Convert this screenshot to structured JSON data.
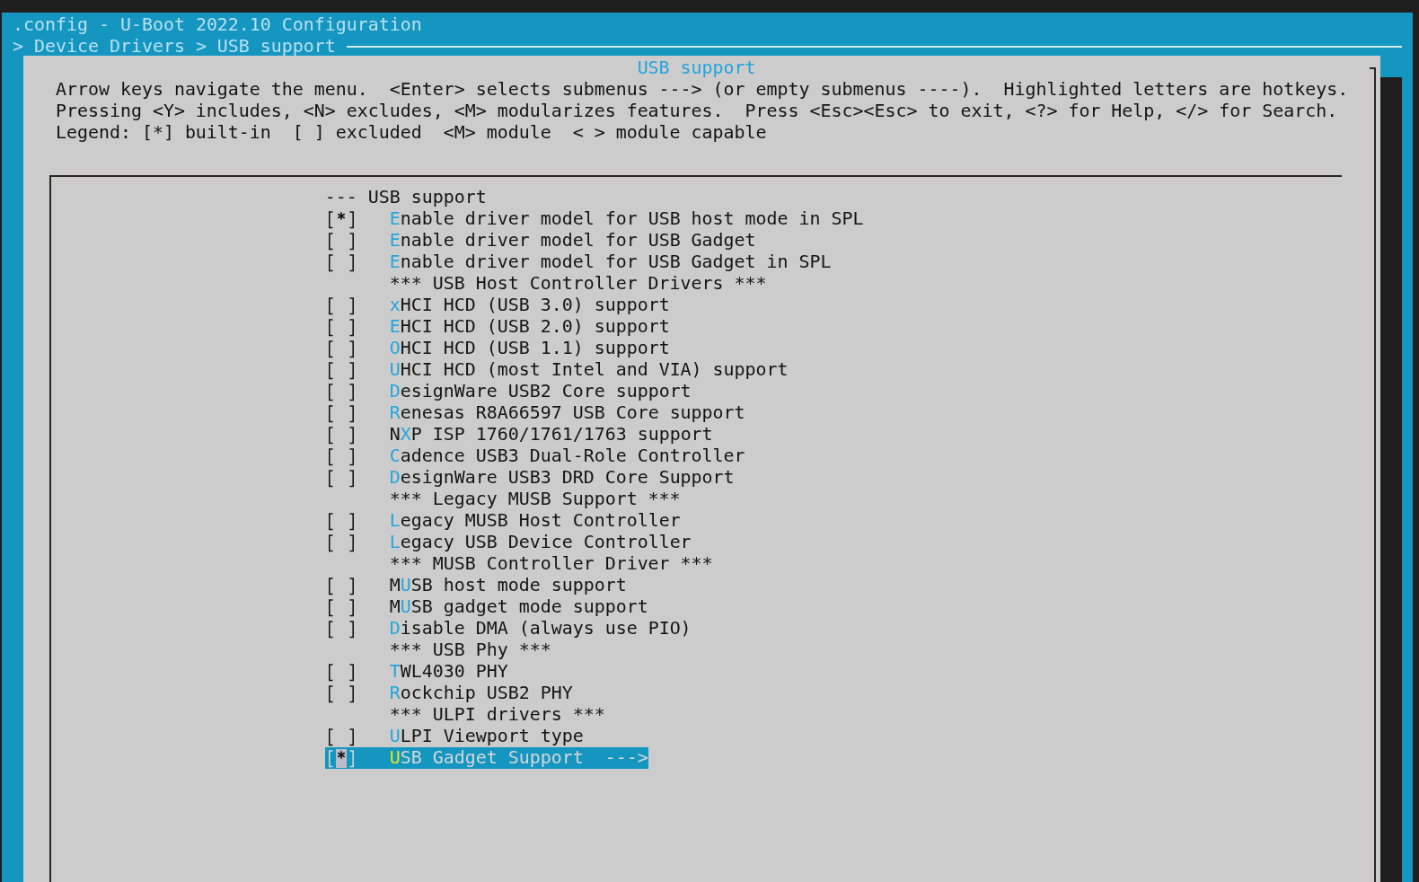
{
  "window_title": ".config - U-Boot 2022.10 Configuration",
  "breadcrumb": "> Device Drivers > USB support",
  "dialog": {
    "title": "USB support",
    "help_lines": [
      "Arrow keys navigate the menu.  <Enter> selects submenus ---> (or empty submenus ----).  Highlighted letters are hotkeys.",
      "Pressing <Y> includes, <N> excludes, <M> modularizes features.  Press <Esc><Esc> to exit, <?> for Help, </> for Search.",
      "Legend: [*] built-in  [ ] excluded  <M> module  < > module capable"
    ],
    "menu": [
      {
        "kind": "header",
        "text": "--- USB support",
        "selected": false
      },
      {
        "kind": "option",
        "checked": true,
        "hotkey": "E",
        "rest": "nable driver model for USB host mode in SPL",
        "selected": false
      },
      {
        "kind": "option",
        "checked": false,
        "hotkey": "E",
        "rest": "nable driver model for USB Gadget",
        "selected": false
      },
      {
        "kind": "option",
        "checked": false,
        "hotkey": "E",
        "rest": "nable driver model for USB Gadget in SPL",
        "selected": false
      },
      {
        "kind": "comment",
        "text": "*** USB Host Controller Drivers ***",
        "selected": false
      },
      {
        "kind": "option",
        "checked": false,
        "hotkey": "x",
        "rest": "HCI HCD (USB 3.0) support",
        "selected": false
      },
      {
        "kind": "option",
        "checked": false,
        "hotkey": "E",
        "rest": "HCI HCD (USB 2.0) support",
        "selected": false
      },
      {
        "kind": "option",
        "checked": false,
        "hotkey": "O",
        "rest": "HCI HCD (USB 1.1) support",
        "selected": false
      },
      {
        "kind": "option",
        "checked": false,
        "hotkey": "U",
        "rest": "HCI HCD (most Intel and VIA) support",
        "selected": false
      },
      {
        "kind": "option",
        "checked": false,
        "hotkey": "D",
        "rest": "esignWare USB2 Core support",
        "selected": false
      },
      {
        "kind": "option",
        "checked": false,
        "hotkey": "R",
        "rest": "enesas R8A66597 USB Core support",
        "selected": false
      },
      {
        "kind": "option",
        "checked": false,
        "prefix": "N",
        "hotkey": "X",
        "rest": "P ISP 1760/1761/1763 support",
        "selected": false
      },
      {
        "kind": "option",
        "checked": false,
        "hotkey": "C",
        "rest": "adence USB3 Dual-Role Controller",
        "selected": false
      },
      {
        "kind": "option",
        "checked": false,
        "hotkey": "D",
        "rest": "esignWare USB3 DRD Core Support",
        "selected": false
      },
      {
        "kind": "comment",
        "text": "*** Legacy MUSB Support ***",
        "selected": false
      },
      {
        "kind": "option",
        "checked": false,
        "hotkey": "L",
        "rest": "egacy MUSB Host Controller",
        "selected": false
      },
      {
        "kind": "option",
        "checked": false,
        "hotkey": "L",
        "rest": "egacy USB Device Controller",
        "selected": false
      },
      {
        "kind": "comment",
        "text": "*** MUSB Controller Driver ***",
        "selected": false
      },
      {
        "kind": "option",
        "checked": false,
        "prefix": "M",
        "hotkey": "U",
        "rest": "SB host mode support",
        "selected": false
      },
      {
        "kind": "option",
        "checked": false,
        "prefix": "M",
        "hotkey": "U",
        "rest": "SB gadget mode support",
        "selected": false
      },
      {
        "kind": "option",
        "checked": false,
        "hotkey": "D",
        "rest": "isable DMA (always use PIO)",
        "selected": false
      },
      {
        "kind": "comment",
        "text": "*** USB Phy ***",
        "selected": false
      },
      {
        "kind": "option",
        "checked": false,
        "hotkey": "T",
        "rest": "WL4030 PHY",
        "selected": false
      },
      {
        "kind": "option",
        "checked": false,
        "hotkey": "R",
        "rest": "ockchip USB2 PHY",
        "selected": false
      },
      {
        "kind": "comment",
        "text": "*** ULPI drivers ***",
        "selected": false
      },
      {
        "kind": "option",
        "checked": false,
        "hotkey": "U",
        "rest": "LPI Viewport type",
        "selected": false
      },
      {
        "kind": "option",
        "checked": true,
        "hotkey": "U",
        "rest": "SB Gadget Support",
        "submenu_arrow": "--->",
        "selected": true
      }
    ]
  }
}
